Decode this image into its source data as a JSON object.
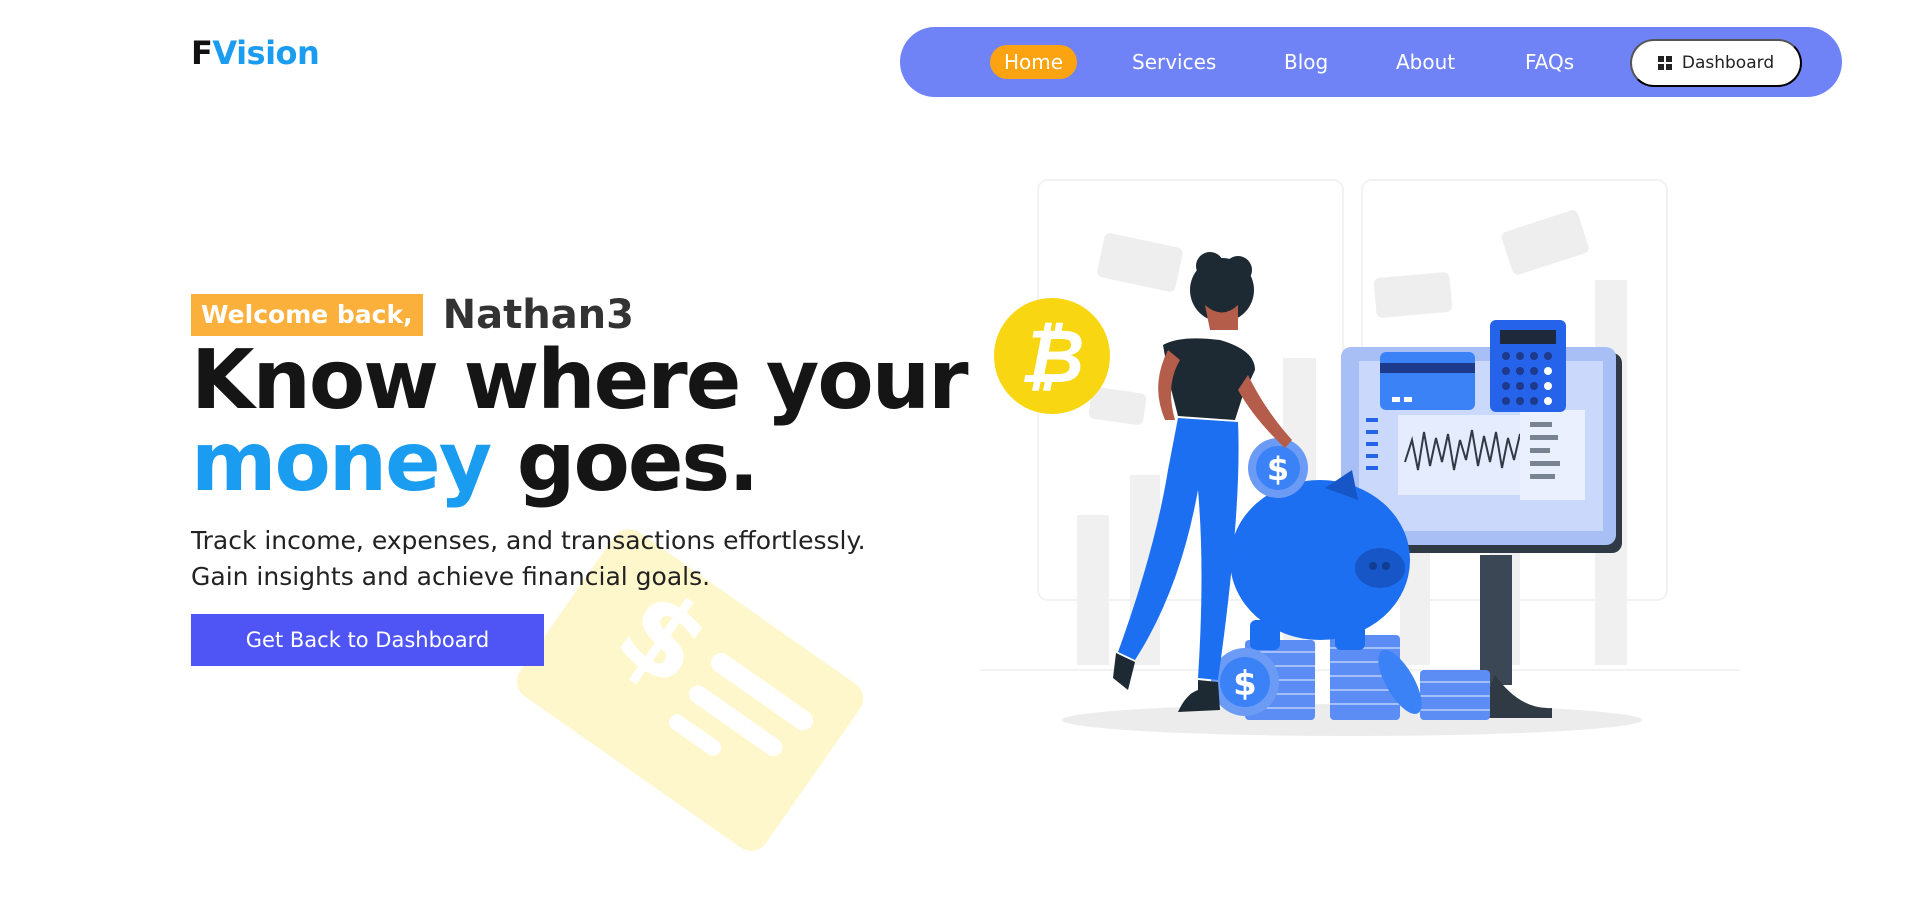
{
  "brand": {
    "logo_f": "F",
    "logo_rest": "Vision",
    "primary": "#1a9cf0",
    "nav_bg": "#6f83f7",
    "active": "#fca311",
    "cta": "#4f55f5"
  },
  "nav": {
    "items": [
      {
        "label": "Home",
        "active": true
      },
      {
        "label": "Services"
      },
      {
        "label": "Blog"
      },
      {
        "label": "About"
      },
      {
        "label": "FAQs"
      }
    ],
    "dashboard_label": "Dashboard",
    "dashboard_icon": "grid-icon"
  },
  "hero": {
    "welcome": "Welcome back,",
    "username": "Nathan3",
    "headline_line1": "Know where your",
    "headline_money": "money",
    "headline_goes": " goes.",
    "subtext": "Track income, expenses, and transactions effortlessly. Gain insights and achieve financial goals.",
    "cta_label": "Get Back to Dashboard"
  },
  "illustration": {
    "name": "finance-illustration",
    "elements": [
      "bitcoin-coin",
      "woman-figure",
      "piggy-bank",
      "coin-stacks",
      "monitor-with-chart",
      "calculator",
      "credit-card",
      "dollar-bills"
    ]
  }
}
